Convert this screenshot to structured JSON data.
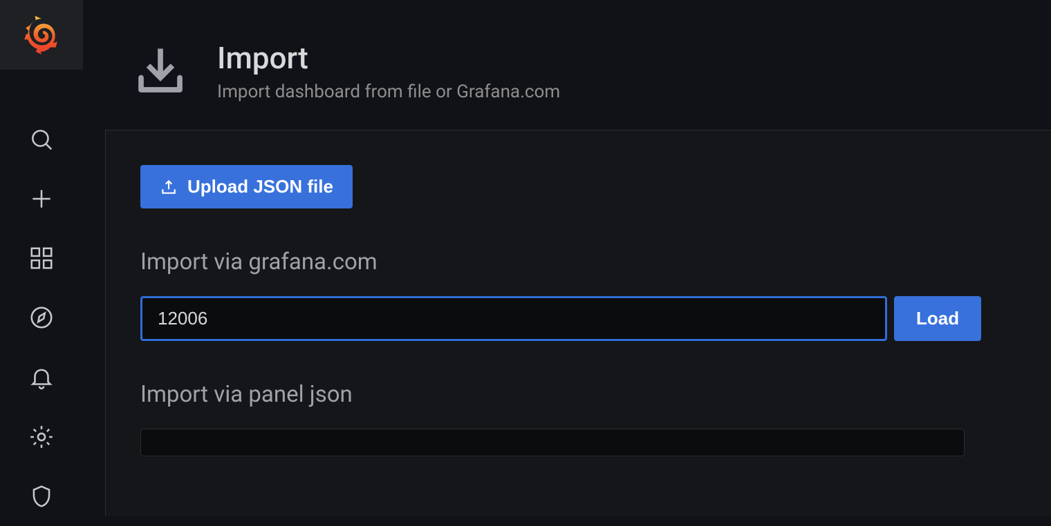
{
  "header": {
    "title": "Import",
    "subtitle": "Import dashboard from file or Grafana.com"
  },
  "upload_button_label": "Upload JSON file",
  "section_grafana_label": "Import via grafana.com",
  "grafana_id_value": "12006",
  "load_button_label": "Load",
  "section_panel_json_label": "Import via panel json",
  "panel_json_value": ""
}
